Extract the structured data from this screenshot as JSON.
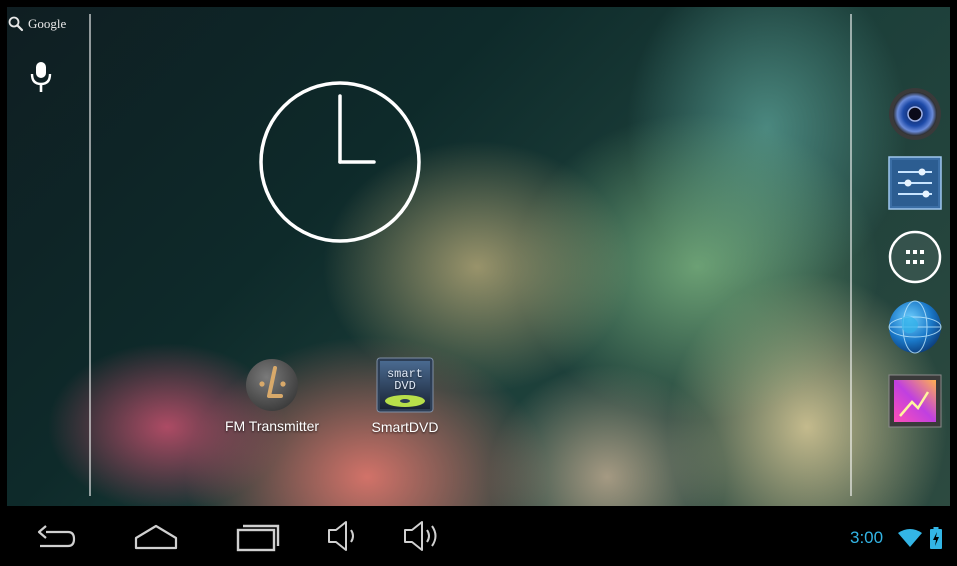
{
  "search": {
    "label": "Google"
  },
  "apps": [
    {
      "label": "FM Transmitter",
      "icon": "fm-transmitter-icon"
    },
    {
      "label": "SmartDVD",
      "icon": "smartdvd-icon",
      "icon_text_top": "smart",
      "icon_text_bottom": "DVD"
    }
  ],
  "dock": [
    {
      "icon": "speaker-icon"
    },
    {
      "icon": "settings-sliders-icon"
    },
    {
      "icon": "app-drawer-icon"
    },
    {
      "icon": "browser-globe-icon"
    },
    {
      "icon": "gallery-icon"
    }
  ],
  "navigation": [
    {
      "icon": "back-icon"
    },
    {
      "icon": "home-icon"
    },
    {
      "icon": "recent-apps-icon"
    },
    {
      "icon": "volume-down-icon"
    },
    {
      "icon": "volume-up-icon"
    }
  ],
  "status_bar": {
    "time": "3:00",
    "wifi": "wifi-icon",
    "battery": "battery-charging-icon"
  },
  "colors": {
    "accent": "#33b5e5",
    "navbar": "#000000"
  }
}
